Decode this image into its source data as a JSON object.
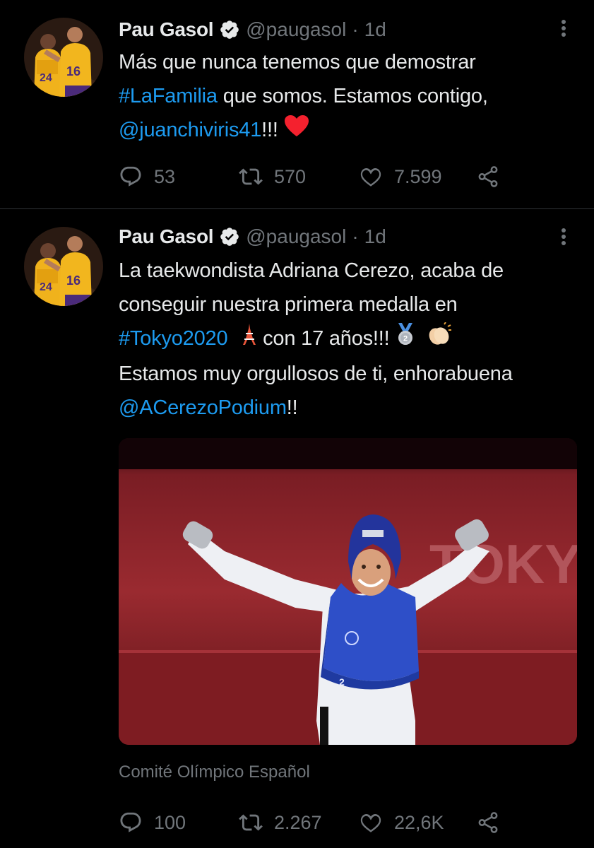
{
  "tweets": [
    {
      "author": {
        "name": "Pau Gasol",
        "handle": "@paugasol",
        "time": "1d",
        "separator": "·"
      },
      "text": {
        "line1": "Más que nunca tenemos que demostrar",
        "hashtag": "#LaFamilia",
        "line2_rest": " que somos. Estamos contigo,",
        "mention": "@juanchiviris41",
        "line3_rest": "!!!"
      },
      "emojis": [
        "red-heart"
      ],
      "stats": {
        "replies": "53",
        "retweets": "570",
        "likes": "7.599"
      }
    },
    {
      "author": {
        "name": "Pau Gasol",
        "handle": "@paugasol",
        "time": "1d",
        "separator": "·"
      },
      "text": {
        "line1": "La taekwondista Adriana Cerezo, acaba de",
        "line2": "conseguir nuestra primera medalla en",
        "hashtag": "#Tokyo2020",
        "line3_rest": " con 17 años!!!",
        "line4": "Estamos muy orgullosos de ti, enhorabuena",
        "mention": "@ACerezoPodium",
        "line5_rest": "!!"
      },
      "emojis": [
        "tokyo-tower",
        "silver-medal",
        "clapping-hands"
      ],
      "media": {
        "description_text": "TOKYO",
        "bib_number": "2"
      },
      "source": "Comité Olímpico Español",
      "stats": {
        "replies": "100",
        "retweets": "2.267",
        "likes": "22,6K"
      }
    }
  ],
  "colors": {
    "background": "#000000",
    "text": "#e7e9ea",
    "muted": "#71767b",
    "link": "#1d9bf0",
    "heart": "#f4212e"
  },
  "icons": [
    "verified-badge-icon",
    "more-icon",
    "reply-icon",
    "retweet-icon",
    "like-icon",
    "share-icon"
  ]
}
